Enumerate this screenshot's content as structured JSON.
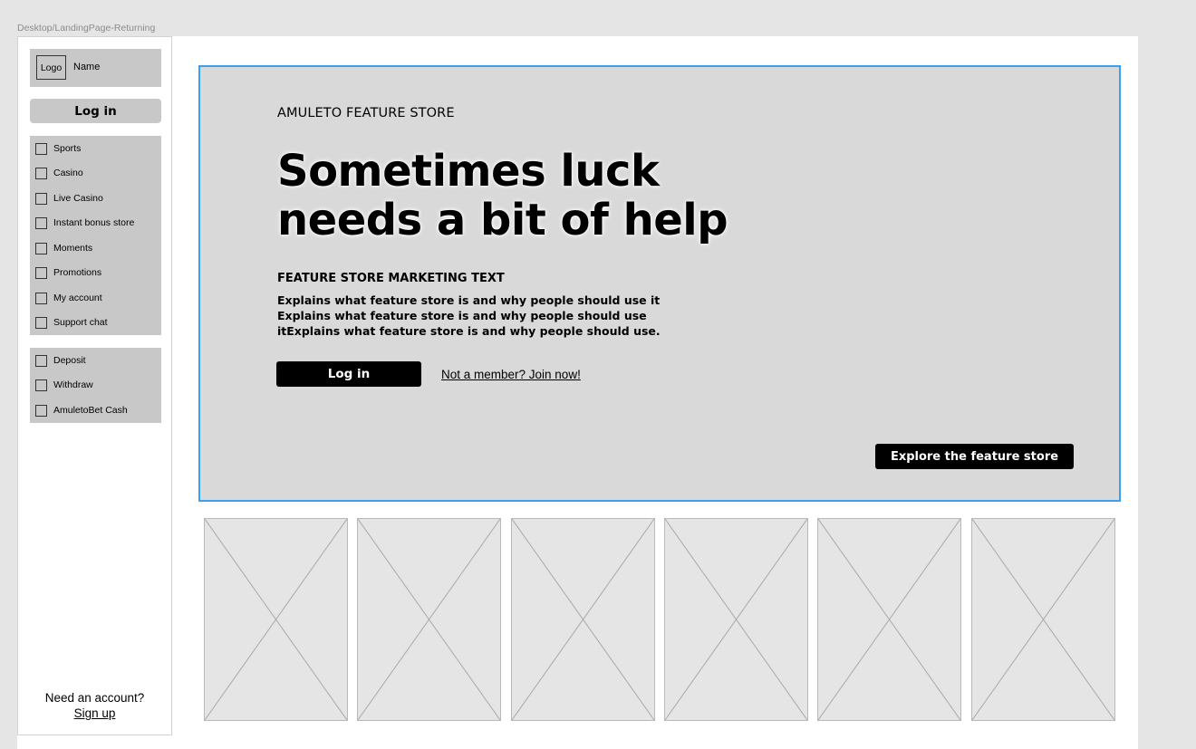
{
  "frame": {
    "label": "Desktop/LandingPage-Returning"
  },
  "sidebar": {
    "logo": {
      "logo_text": "Logo",
      "name": "Name"
    },
    "login_label": "Log in",
    "nav_items": [
      {
        "label": "Sports"
      },
      {
        "label": "Casino"
      },
      {
        "label": "Live Casino"
      },
      {
        "label": "Instant bonus store"
      },
      {
        "label": "Moments"
      },
      {
        "label": "Promotions"
      },
      {
        "label": "My account"
      },
      {
        "label": "Support chat"
      }
    ],
    "wallet_items": [
      {
        "label": "Deposit"
      },
      {
        "label": "Withdraw"
      },
      {
        "label": "AmuletoBet Cash"
      }
    ],
    "footer": {
      "prompt": "Need an account?",
      "signup_label": "Sign up"
    }
  },
  "hero": {
    "eyebrow": "AMULETO FEATURE STORE",
    "headline_line1": "Sometimes luck",
    "headline_line2": "needs a bit of help",
    "marketing_title": "FEATURE STORE MARKETING TEXT",
    "marketing_body": "Explains what feature store is and why people should use it Explains what feature store is and why people should use itExplains what feature store is and why people should use.",
    "login_label": "Log in",
    "join_label": "Not a member? Join now!",
    "explore_label": "Explore the feature store"
  },
  "cards": [
    {
      "icon": "image-placeholder-icon"
    },
    {
      "icon": "image-placeholder-icon"
    },
    {
      "icon": "image-placeholder-icon"
    },
    {
      "icon": "image-placeholder-icon"
    },
    {
      "icon": "image-placeholder-icon"
    },
    {
      "icon": "image-placeholder-icon"
    }
  ],
  "colors": {
    "background": "#e5e5e5",
    "hero_bg": "#d9d9d9",
    "selection_outline": "#3aa1f2",
    "sidebar_block": "#c8c8c8",
    "button_dark": "#000000"
  }
}
